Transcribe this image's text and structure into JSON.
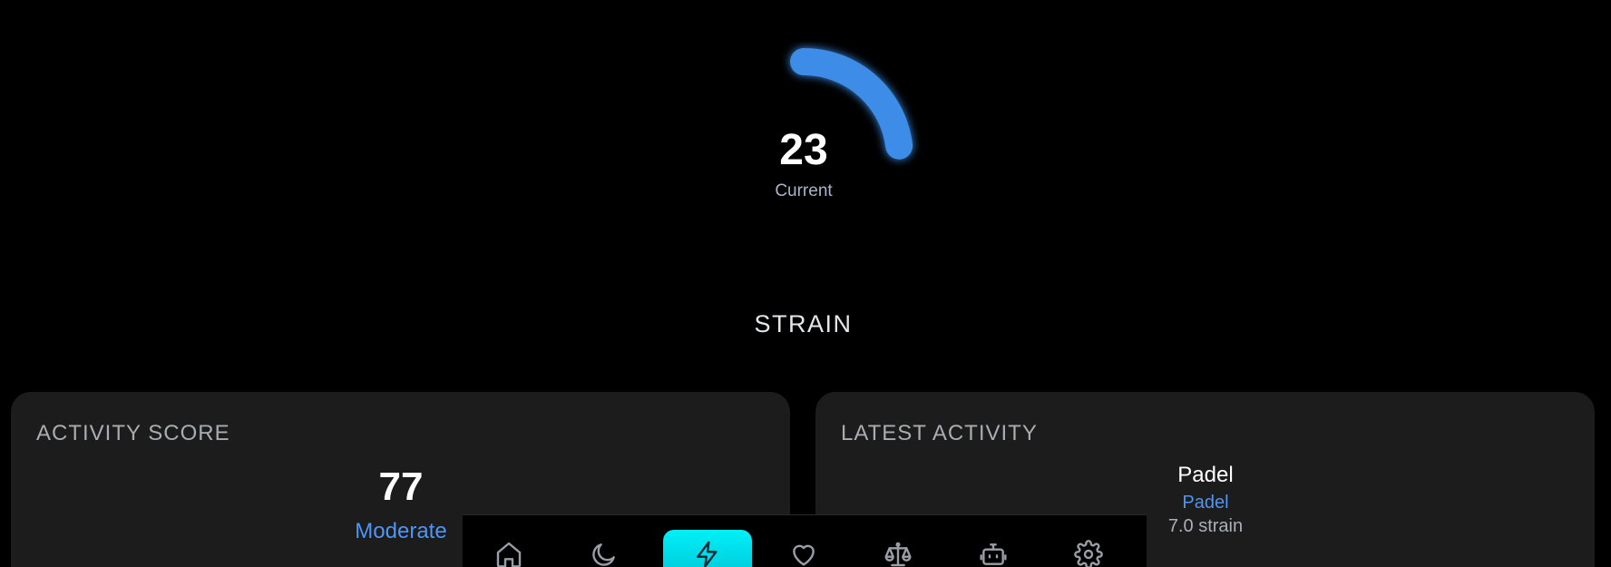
{
  "gauge": {
    "value": "23",
    "label": "Current",
    "fraction": 0.23,
    "color": "#3d8ce8"
  },
  "section_title": "STRAIN",
  "activity_score": {
    "title": "ACTIVITY SCORE",
    "value": "77",
    "level": "Moderate"
  },
  "latest_activity": {
    "title": "LATEST ACTIVITY",
    "name": "Padel",
    "type": "Padel",
    "strain": "7.0 strain"
  },
  "nav": {
    "items": [
      {
        "icon": "home-icon",
        "active": false
      },
      {
        "icon": "moon-icon",
        "active": false
      },
      {
        "icon": "lightning-icon",
        "active": true
      },
      {
        "icon": "heart-icon",
        "active": false
      },
      {
        "icon": "scale-icon",
        "active": false
      },
      {
        "icon": "robot-icon",
        "active": false
      },
      {
        "icon": "gear-icon",
        "active": false
      }
    ]
  },
  "colors": {
    "accent_blue": "#4f95f3",
    "active_tab": "#00e5f0",
    "card_bg": "#1c1c1c",
    "background": "#000000"
  }
}
